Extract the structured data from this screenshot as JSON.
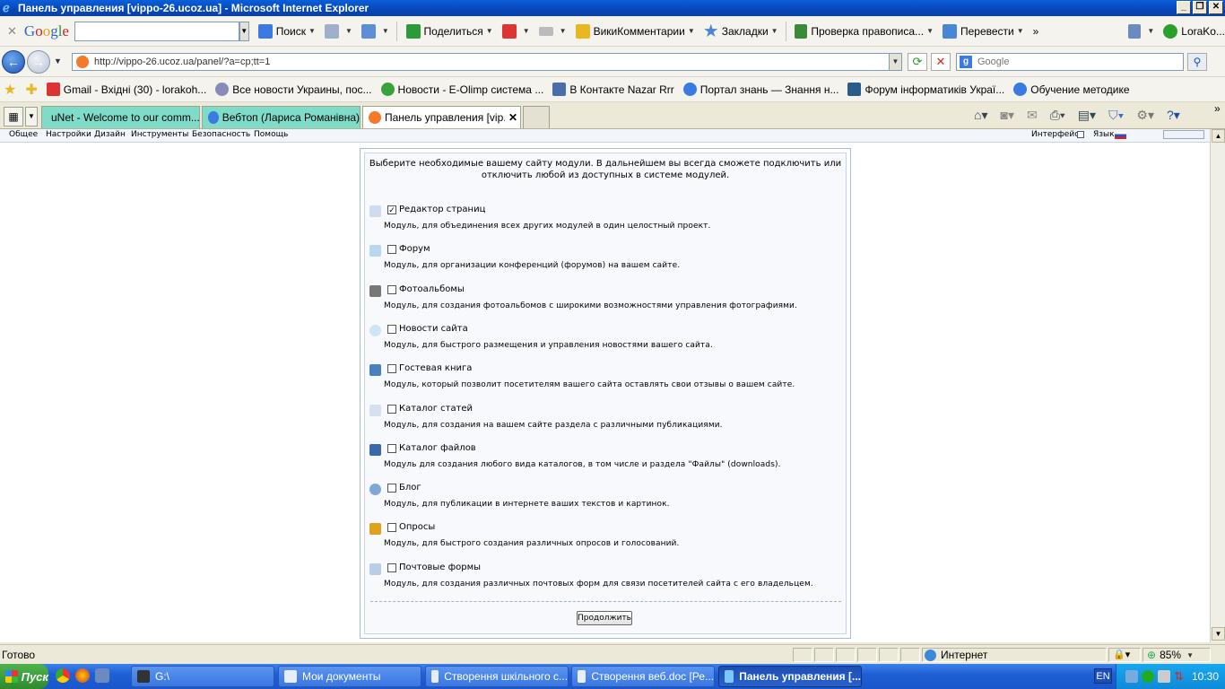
{
  "window": {
    "title": "Панель управления [vippo-26.ucoz.ua] - Microsoft Internet Explorer"
  },
  "google_toolbar": {
    "logo": "Google",
    "search_label": "Поиск",
    "share_label": "Поделиться",
    "wiki_label": "ВикиКомментарии",
    "bookmarks_label": "Закладки",
    "spell_label": "Проверка правописа...",
    "translate_label": "Перевести",
    "more": "»",
    "user": "LoraKo..."
  },
  "address_bar": {
    "url": "http://vippo-26.ucoz.ua/panel/?a=cp;tt=1",
    "search_placeholder": "Google"
  },
  "favorites": [
    {
      "label": "Gmail - Вхідні (30) - lorakoh...",
      "color": "#d33"
    },
    {
      "label": "Все новости Украины, пос...",
      "color": "#7a7aa8"
    },
    {
      "label": "Новости - E-Olimp система ...",
      "color": "#3aa23a"
    },
    {
      "label": "В Контакте  Nazar Rrr",
      "color": "#4a6ea8"
    },
    {
      "label": "Портал знань — Знання н...",
      "color": "#3b7ae0"
    },
    {
      "label": "Форум інформатиків Украї...",
      "color": "#2a5c8a"
    },
    {
      "label": "Обучение методике",
      "color": "#3b7ae0"
    }
  ],
  "tabs": [
    {
      "label": "uNet - Welcome to our comm..."
    },
    {
      "label": "Вебтоп (Лариса Романівна)"
    },
    {
      "label": "Панель управления [vip..."
    }
  ],
  "cp_menu": {
    "items": [
      "Общее",
      "Настройки",
      "Дизайн",
      "Инструменты",
      "Безопасность",
      "Помощь"
    ],
    "interface_label": "Интерфейс",
    "language_label": "Язык"
  },
  "panel": {
    "intro": "Выберите необходимые вашему сайту модули. В дальнейшем вы всегда сможете подключить или отключить любой из доступных в системе модулей.",
    "modules": [
      {
        "name": "Редактор страниц",
        "checked": true,
        "icon": "page-icon",
        "desc": "Модуль, для объединения всех других модулей в один целостный проект."
      },
      {
        "name": "Форум",
        "checked": false,
        "icon": "forum-icon",
        "desc": "Модуль, для организации конференций (форумов) на вашем сайте."
      },
      {
        "name": "Фотоальбомы",
        "checked": false,
        "icon": "camera-icon",
        "desc": "Модуль, для создания фотоальбомов с широкими возможностями управления фотографиями."
      },
      {
        "name": "Новости сайта",
        "checked": false,
        "icon": "bulb-icon",
        "desc": "Модуль, для быстрого размещения и управления новостями вашего сайта."
      },
      {
        "name": "Гостевая книга",
        "checked": false,
        "icon": "book-icon",
        "desc": "Модуль, который позволит посетителям вашего сайта оставлять свои отзывы о вашем сайте."
      },
      {
        "name": "Каталог статей",
        "checked": false,
        "icon": "article-icon",
        "desc": "Модуль, для создания на вашем сайте раздела с различными публикациями."
      },
      {
        "name": "Каталог файлов",
        "checked": false,
        "icon": "floppy-icon",
        "desc": "Модуль для создания любого вида каталогов, в том числе и раздела \"Файлы\" (downloads)."
      },
      {
        "name": "Блог",
        "checked": false,
        "icon": "blog-icon",
        "desc": "Модуль, для публикации в интернете ваших текстов и картинок."
      },
      {
        "name": "Опросы",
        "checked": false,
        "icon": "chart-icon",
        "desc": "Модуль, для быстрого создания различных опросов и голосований."
      },
      {
        "name": "Почтовые формы",
        "checked": false,
        "icon": "mail-icon",
        "desc": "Модуль, для создания различных почтовых форм для связи посетителей сайта с его владельцем."
      }
    ],
    "continue_label": "Продолжить"
  },
  "status": {
    "left": "Готово",
    "zone": "Интернет",
    "zoom": "85%"
  },
  "taskbar": {
    "start": "Пуск",
    "drive": "G:\\",
    "items": [
      {
        "label": "Мои документы",
        "active": false
      },
      {
        "label": "Створення шкільного с...",
        "active": false
      },
      {
        "label": "Створення веб.doc [Ре...",
        "active": false
      },
      {
        "label": "Панель управления [...",
        "active": true
      }
    ],
    "lang": "EN",
    "clock": "10:30"
  }
}
